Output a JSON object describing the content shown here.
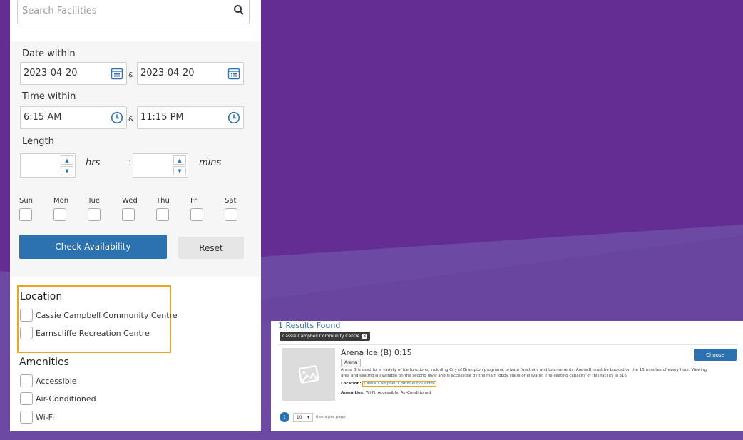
{
  "search": {
    "placeholder": "Search Facilities"
  },
  "filters": {
    "date_label": "Date within",
    "date_from": "2023-04-20",
    "date_to": "2023-04-20",
    "time_label": "Time within",
    "time_from": "6:15 AM",
    "time_to": "11:15 PM",
    "length_label": "Length",
    "hrs": "hrs",
    "mins": "mins",
    "colon": ":",
    "amp": "&",
    "days": [
      "Sun",
      "Mon",
      "Tue",
      "Wed",
      "Thu",
      "Fri",
      "Sat"
    ],
    "check_label": "Check Availability",
    "reset_label": "Reset"
  },
  "location": {
    "title": "Location",
    "items": [
      "Cassie Campbell Community Centre",
      "Earnscliffe Recreation Centre"
    ]
  },
  "amenities": {
    "title": "Amenities",
    "items": [
      "Accessible",
      "Air-Conditioned",
      "Wi-Fi"
    ]
  },
  "results": {
    "count_text": "1 Results Found",
    "chip": "Cassie Campbell Community Centre",
    "facility": {
      "name": "Arena Ice (B) 0:15",
      "tag": "Arena",
      "description": "Arena B is used for a variety of ice functions, including City of Brampton programs, private functions and tournaments. Arena B must be booked on the 15 minutes of every hour. Viewing area and seating is available on the second level and is accessible by the main lobby stairs or elevator. The seating capacity of this facility is 316.",
      "location_label": "Location:",
      "location_value": "Cassie Campbell Community Centre",
      "amenities_label": "Amenities:",
      "amenities_value": "Wi-Fi, Accessible, Air-Conditioned"
    },
    "choose_label": "Choose",
    "page": "1",
    "per_page": "10",
    "per_page_label": "items per page"
  },
  "colors": {
    "purple": "#5f2c91",
    "blue": "#2c72b0",
    "highlight": "#f0a31c"
  }
}
